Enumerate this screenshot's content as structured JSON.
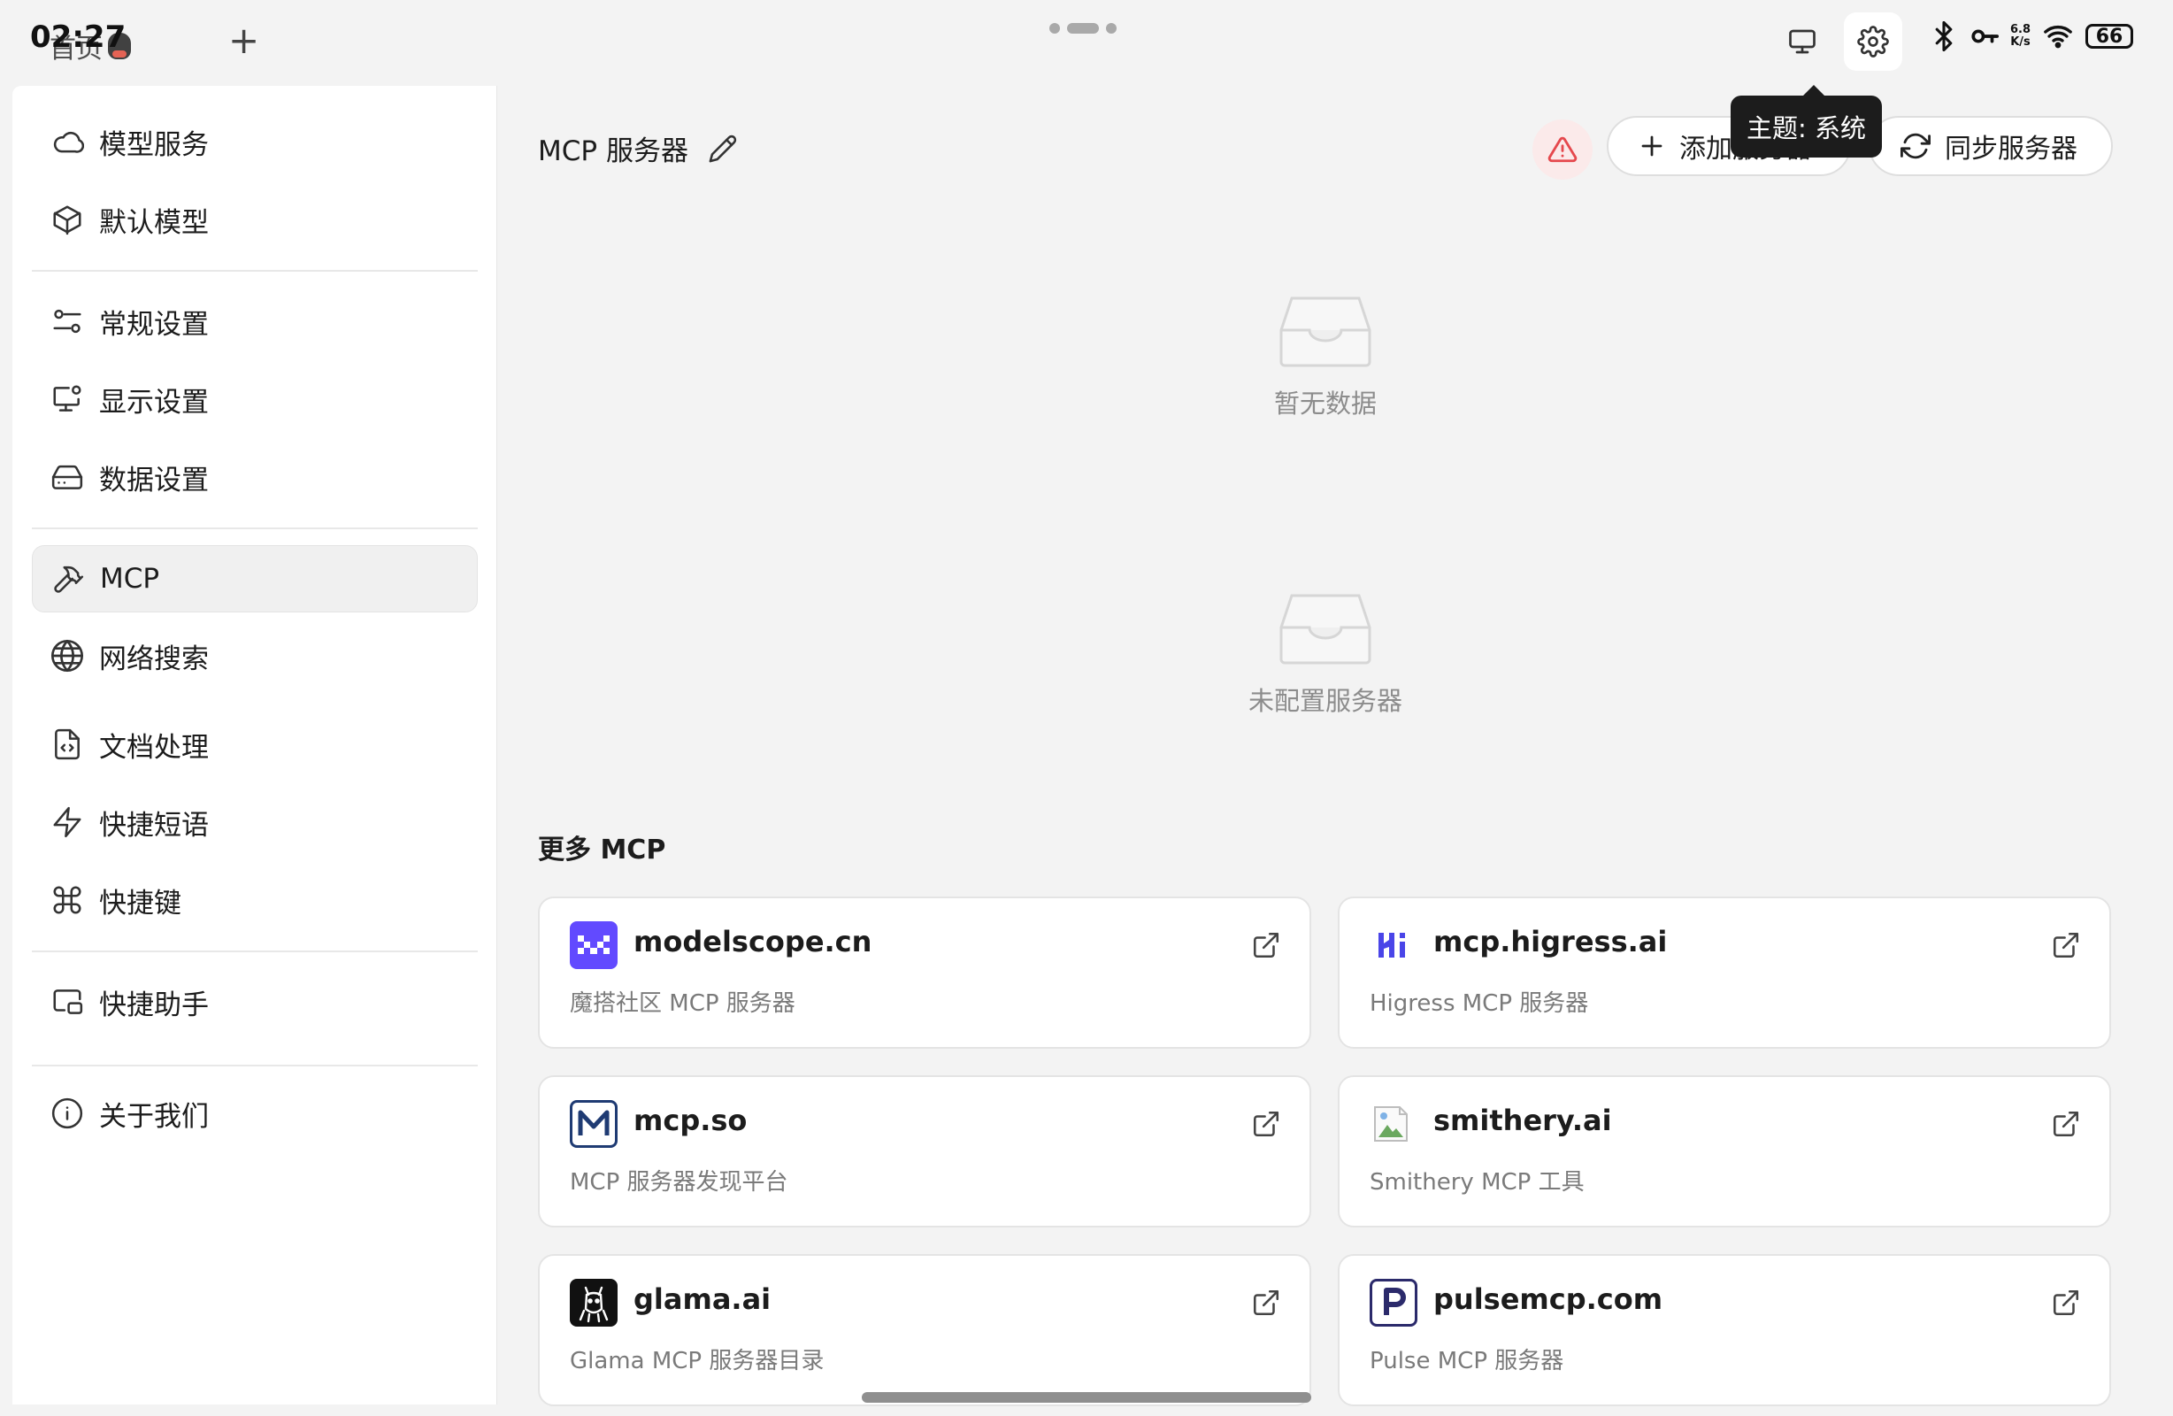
{
  "statusbar": {
    "time": "02:27",
    "home_tab_label": "首页",
    "net_speed_value": "6.8",
    "net_speed_unit": "K/s",
    "battery": "66"
  },
  "tooltip": {
    "text": "主题: 系统"
  },
  "sidebar": {
    "items": [
      {
        "label": "模型服务",
        "icon": "cloud-icon"
      },
      {
        "label": "默认模型",
        "icon": "cube-icon"
      },
      {
        "label": "常规设置",
        "icon": "sliders-icon"
      },
      {
        "label": "显示设置",
        "icon": "monitor-settings-icon"
      },
      {
        "label": "数据设置",
        "icon": "hard-drive-icon"
      },
      {
        "label": "MCP",
        "icon": "hammer-icon"
      },
      {
        "label": "网络搜索",
        "icon": "globe-icon"
      },
      {
        "label": "文档处理",
        "icon": "file-code-icon"
      },
      {
        "label": "快捷短语",
        "icon": "zap-icon"
      },
      {
        "label": "快捷键",
        "icon": "command-icon"
      },
      {
        "label": "快捷助手",
        "icon": "picture-in-picture-icon"
      },
      {
        "label": "关于我们",
        "icon": "info-icon"
      }
    ],
    "active_index": 5
  },
  "main": {
    "title": "MCP 服务器",
    "add_server_label": "添加服务器",
    "sync_server_label": "同步服务器",
    "empty_data_label": "暂无数据",
    "no_server_label": "未配置服务器",
    "more_title": "更多 MCP",
    "cards": [
      {
        "name": "modelscope.cn",
        "desc": "魔搭社区 MCP 服务器",
        "logo": "modelscope-logo"
      },
      {
        "name": "mcp.higress.ai",
        "desc": "Higress MCP 服务器",
        "logo": "higress-logo"
      },
      {
        "name": "mcp.so",
        "desc": "MCP 服务器发现平台",
        "logo": "mcpso-logo"
      },
      {
        "name": "smithery.ai",
        "desc": "Smithery MCP 工具",
        "logo": "smithery-logo"
      },
      {
        "name": "glama.ai",
        "desc": "Glama MCP 服务器目录",
        "logo": "glama-logo"
      },
      {
        "name": "pulsemcp.com",
        "desc": "Pulse MCP 服务器",
        "logo": "pulsemcp-logo"
      }
    ]
  },
  "colors": {
    "background": "#f3f3f3",
    "panel": "#ffffff",
    "warning": "#e5484d",
    "modelscope": "#624aff",
    "higress": "#4a45e8",
    "mcpso": "#1f3b73",
    "pulsemcp": "#2b2a6b"
  }
}
